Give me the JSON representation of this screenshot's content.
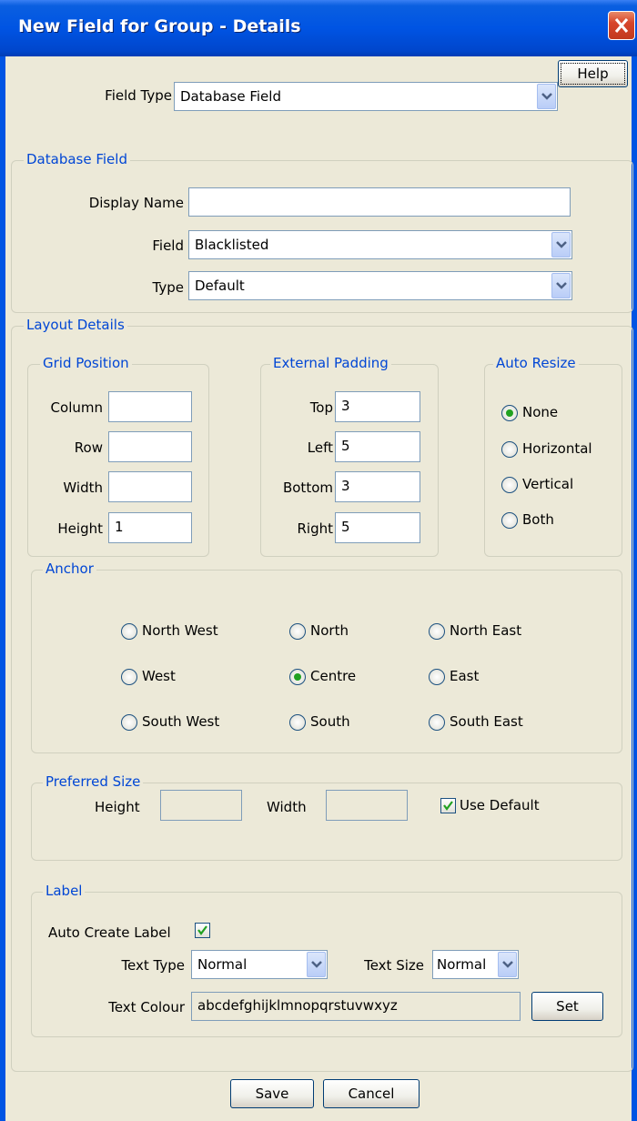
{
  "window": {
    "title": "New Field for Group - Details"
  },
  "help_label": "Help",
  "field_type": {
    "label": "Field Type",
    "value": "Database Field"
  },
  "database_field": {
    "group_title": "Database Field",
    "display_name_label": "Display Name",
    "display_name_value": "",
    "field_label": "Field",
    "field_value": "Blacklisted",
    "type_label": "Type",
    "type_value": "Default"
  },
  "layout": {
    "group_title": "Layout Details",
    "grid": {
      "title": "Grid Position",
      "column_label": "Column",
      "column_value": "",
      "row_label": "Row",
      "row_value": "",
      "width_label": "Width",
      "width_value": "",
      "height_label": "Height",
      "height_value": "1"
    },
    "padding": {
      "title": "External Padding",
      "top_label": "Top",
      "top_value": "3",
      "left_label": "Left",
      "left_value": "5",
      "bottom_label": "Bottom",
      "bottom_value": "3",
      "right_label": "Right",
      "right_value": "5"
    },
    "auto_resize": {
      "title": "Auto Resize",
      "options": [
        "None",
        "Horizontal",
        "Vertical",
        "Both"
      ],
      "selected": "None"
    },
    "anchor": {
      "title": "Anchor",
      "options": [
        "North West",
        "North",
        "North East",
        "West",
        "Centre",
        "East",
        "South West",
        "South",
        "South East"
      ],
      "selected": "Centre"
    },
    "preferred_size": {
      "title": "Preferred Size",
      "height_label": "Height",
      "height_value": "",
      "width_label": "Width",
      "width_value": "",
      "use_default_label": "Use Default",
      "use_default_checked": true
    },
    "label": {
      "title": "Label",
      "auto_create_label": "Auto Create Label",
      "auto_create_checked": true,
      "text_type_label": "Text Type",
      "text_type_value": "Normal",
      "text_size_label": "Text Size",
      "text_size_value": "Normal",
      "text_colour_label": "Text Colour",
      "text_colour_value": "abcdefghijklmnopqrstuvwxyz",
      "set_label": "Set"
    }
  },
  "footer": {
    "save_label": "Save",
    "cancel_label": "Cancel"
  },
  "colors": {
    "title_bar": "#0054e3",
    "group_title": "#0046d5",
    "radio_dot": "#21a121"
  }
}
